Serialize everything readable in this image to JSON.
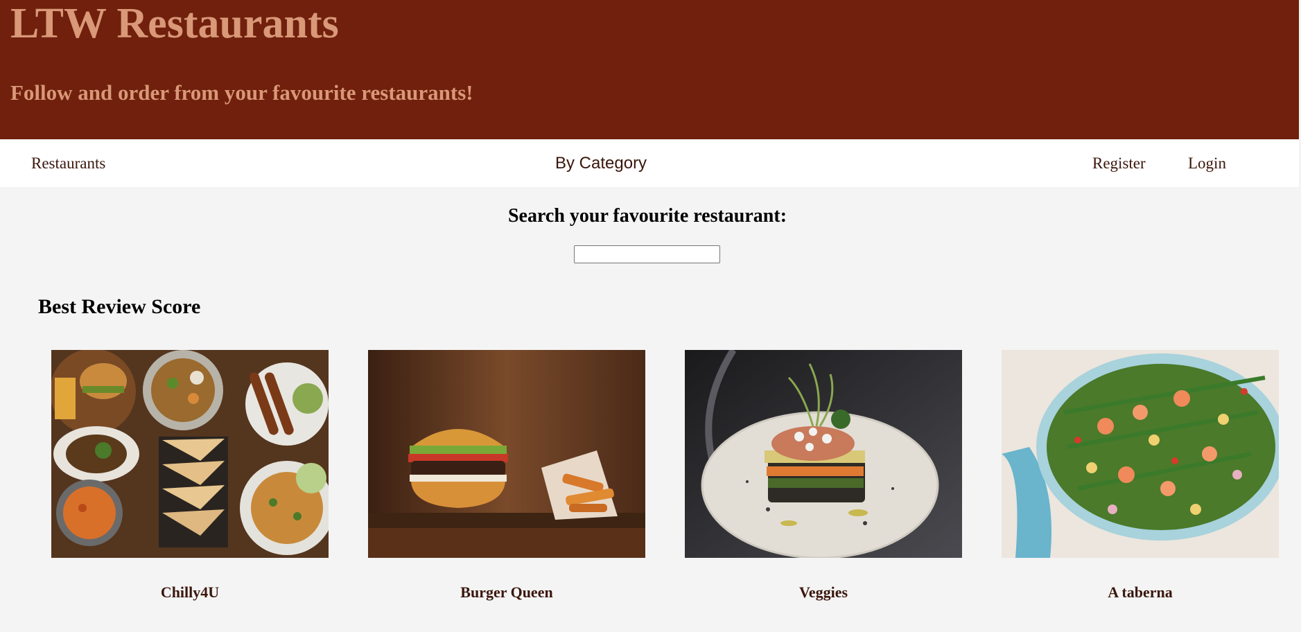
{
  "header": {
    "title": "LTW Restaurants",
    "subtitle": "Follow and order from your favourite restaurants!"
  },
  "nav": {
    "restaurants": "Restaurants",
    "by_category": "By Category",
    "register": "Register",
    "login": "Login"
  },
  "search": {
    "heading": "Search your favourite restaurant:",
    "value": "",
    "placeholder": ""
  },
  "best_review": {
    "heading": "Best Review Score",
    "restaurants": [
      {
        "name": "Chilly4U"
      },
      {
        "name": "Burger Queen"
      },
      {
        "name": "Veggies"
      },
      {
        "name": "A taberna"
      }
    ]
  }
}
